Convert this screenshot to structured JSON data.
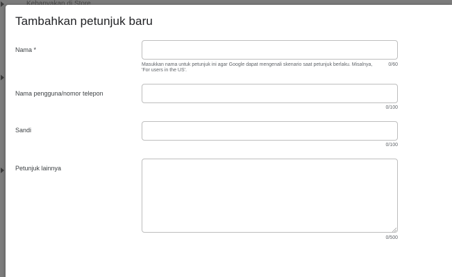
{
  "background": {
    "partial_text": "Kebanyakan di Store"
  },
  "dialog": {
    "title": "Tambahkan petunjuk baru",
    "fields": [
      {
        "label": "Nama  *",
        "value": "",
        "placeholder": "",
        "helper": "Masukkan nama untuk petunjuk ini agar Google dapat mengenali skenario saat petunjuk berlaku. Misalnya, 'For users in the US'.",
        "counter": "0/60"
      },
      {
        "label": "Nama pengguna/nomor telepon",
        "value": "",
        "placeholder": "",
        "counter": "0/100"
      },
      {
        "label": "Sandi",
        "value": "",
        "placeholder": "",
        "counter": "0/100"
      },
      {
        "label": "Petunjuk lainnya",
        "value": "",
        "placeholder": "",
        "counter": "0/500"
      }
    ]
  },
  "colors": {
    "backdrop": "#7c7c7c",
    "dialog_bg": "#ffffff",
    "input_border": "#bdbdbd",
    "text": "#202124",
    "secondary_text": "#5f6368"
  }
}
